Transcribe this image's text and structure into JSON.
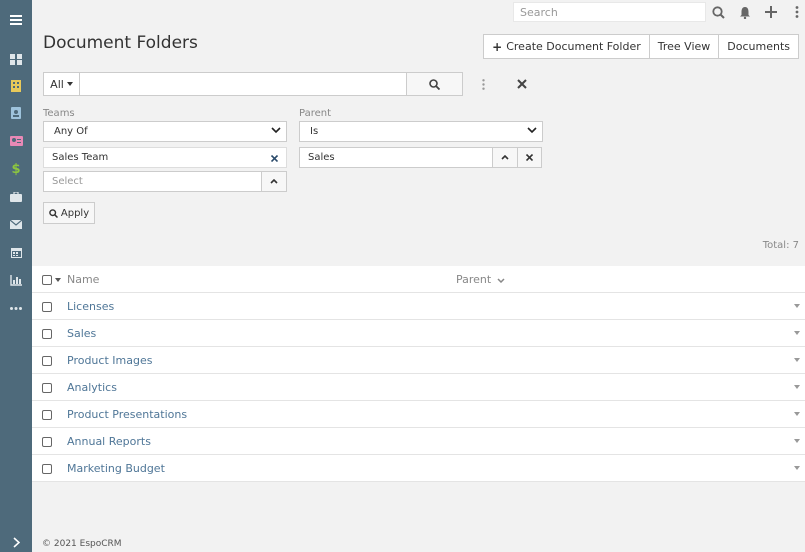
{
  "topbar": {
    "search_placeholder": "Search"
  },
  "page_title": "Document Folders",
  "actions": {
    "create_label": "Create Document Folder",
    "tree_view_label": "Tree View",
    "documents_label": "Documents"
  },
  "filter": {
    "scope_label": "All",
    "teams": {
      "label": "Teams",
      "operator": "Any Of",
      "selected_team": "Sales Team",
      "select_placeholder": "Select"
    },
    "parent": {
      "label": "Parent",
      "operator": "Is",
      "value": "Sales"
    },
    "apply_label": "Apply"
  },
  "total_label": "Total: 7",
  "list": {
    "columns": {
      "name": "Name",
      "parent": "Parent"
    },
    "rows": [
      {
        "name": "Licenses"
      },
      {
        "name": "Sales"
      },
      {
        "name": "Product Images"
      },
      {
        "name": "Analytics"
      },
      {
        "name": "Product Presentations"
      },
      {
        "name": "Annual Reports"
      },
      {
        "name": "Marketing Budget"
      }
    ]
  },
  "footer": {
    "text": "© 2021 EspoCRM"
  },
  "sidebar": {
    "icons": [
      "menu-icon",
      "dashboard-icon",
      "accounts-icon",
      "contacts-icon",
      "leads-icon",
      "opportunities-icon",
      "cases-icon",
      "email-icon",
      "calendar-icon",
      "reports-icon",
      "more-icon",
      "expand-icon"
    ]
  },
  "colors": {
    "sidebar": "#4e6a7b",
    "link": "#4f7697",
    "accent_yellow": "#e8c95a",
    "accent_green": "#8cc63f",
    "accent_pink": "#e889b6"
  }
}
